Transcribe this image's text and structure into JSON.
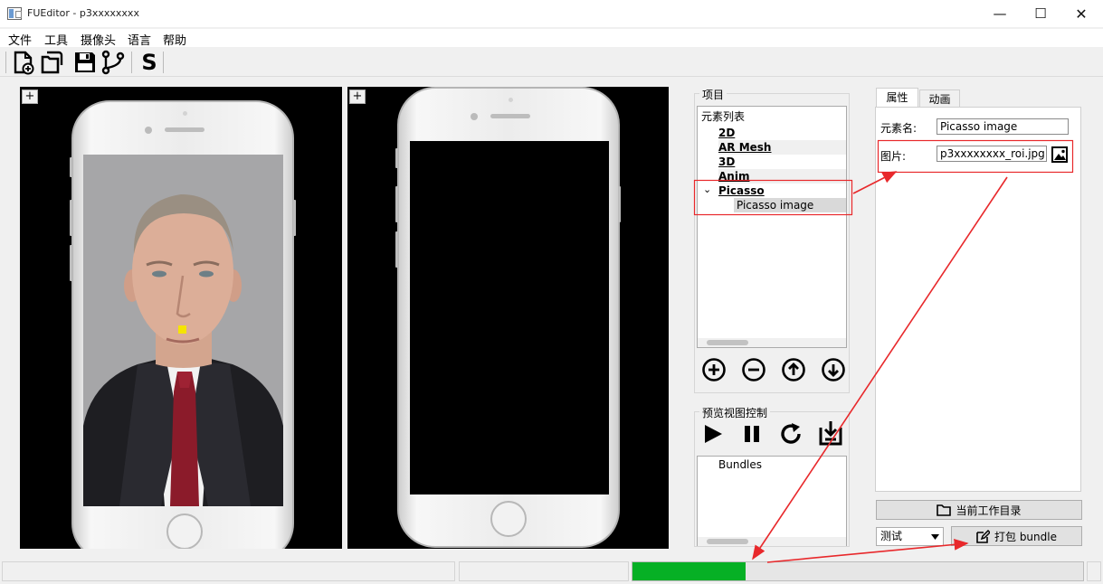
{
  "window": {
    "title": "FUEditor - p3xxxxxxxx",
    "minimize_glyph": "—",
    "maximize_glyph": "☐",
    "close_glyph": "✕"
  },
  "menu": [
    "文件",
    "工具",
    "摄像头",
    "语言",
    "帮助"
  ],
  "toolbar": {
    "icons": [
      "new-file-icon",
      "open-folder-icon",
      "save-icon",
      "git-branch-icon",
      "s-script-icon"
    ],
    "s_label": "S"
  },
  "preview": {
    "left_plus": "+",
    "right_plus": "+"
  },
  "project": {
    "group_title": "项目",
    "tree": {
      "root": "元素列表",
      "items": [
        "2D",
        "AR Mesh",
        "3D",
        "Anim"
      ],
      "expanded_item": "Picasso",
      "expand_glyph": "⌄",
      "child": "Picasso image"
    },
    "buttons": [
      "add-icon",
      "remove-icon",
      "move-up-icon",
      "move-down-icon"
    ]
  },
  "preview_control": {
    "group_title": "预览视图控制",
    "icons": [
      "play-icon",
      "pause-icon",
      "refresh-icon",
      "export-icon"
    ],
    "bundles_label": "Bundles"
  },
  "properties": {
    "tabs": [
      "属性",
      "动画"
    ],
    "active_tab": "属性",
    "name_label": "元素名:",
    "name_value": "Picasso image",
    "image_label": "图片:",
    "image_value": "p3xxxxxxxx_roi.jpg"
  },
  "bottom": {
    "workdir_button": "当前工作目录",
    "combo_value": "测试",
    "pack_button": "打包 bundle"
  },
  "status": {
    "progress_fraction": 0.25
  },
  "colors": {
    "progress_green": "#06b025",
    "annotation_red": "#e8282b"
  }
}
